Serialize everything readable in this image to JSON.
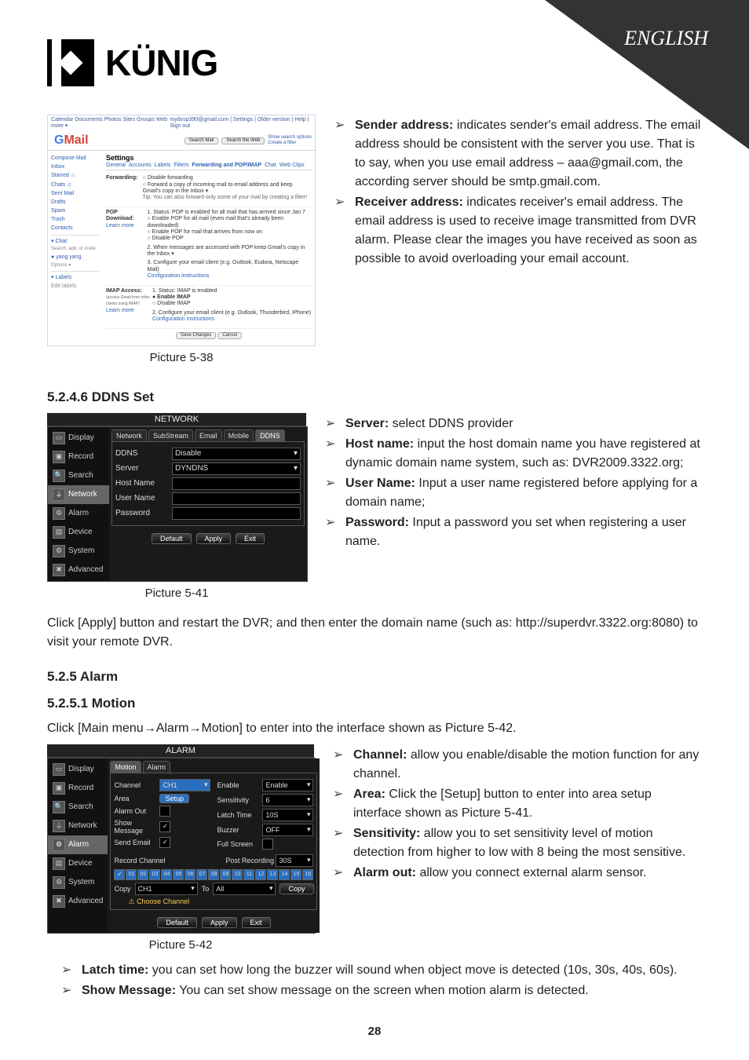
{
  "corner": {
    "language": "ENGLISH"
  },
  "logo": {
    "text": "KÜNIG"
  },
  "fig38": {
    "caption": "Picture 5-38",
    "gmail": {
      "topLeft": "Calendar Documents Photos Sites Groups Web more ▾",
      "topRight": "mydvsp390@gmail.com | Settings | Older version | Help | Sign out",
      "searchMail": "Search Mail",
      "searchWeb": "Search the Web",
      "searchHint": "Show search options\nCreate a filter",
      "logoG": "G",
      "logoMail": "Mail",
      "nav": [
        "Compose Mail",
        "Inbox",
        "Starred ☆",
        "Chats ♫",
        "Sent Mail",
        "Drafts",
        "Spam",
        "Trash",
        "Contacts",
        "▾ Chat",
        "Search, add, or invite",
        "● yang yang",
        "Options ▾",
        "▾ Labels",
        "Edit labels"
      ],
      "settingsTitle": "Settings",
      "tabs": [
        "General",
        "Accounts",
        "Labels",
        "Filters",
        "Forwarding and POP/IMAP",
        "Chat",
        "Web Clips"
      ],
      "fwdLabel": "Forwarding:",
      "fwd1": "○ Disable forwarding",
      "fwd2": "○ Forward a copy of incoming mail to  email address   and  keep Gmail's copy in the Inbox ▾",
      "fwdTip": "Tip: You can also forward only some of your mail by creating a filter!",
      "popLabel": "POP Download:",
      "popMore": "Learn more",
      "pop1": "1. Status: POP is enabled for all mail that has arrived since Jan 7",
      "pop2": "○ Enable POP for all mail (even mail that's already been downloaded)",
      "pop3": "○ Enable POP for mail that arrives from now on",
      "pop4": "○ Disable POP",
      "pop5": "2. When messages are accessed with POP  keep Gmail's copy in the Inbox   ▾",
      "pop6": "3. Configure your email client (e.g. Outlook, Eudora, Netscape Mail)",
      "pop7": "Configuration instructions",
      "imapLabel": "IMAP Access:",
      "imapSub": "(access Gmail from other clients using IMAP)",
      "imapMore": "Learn more",
      "imap1": "1. Status: IMAP is enabled",
      "imap2": "● Enable IMAP",
      "imap3": "○ Disable IMAP",
      "imap4": "2. Configure your email client (e.g. Outlook, Thunderbird, iPhone)",
      "imap5": "Configuration instructions",
      "save": "Save Changes",
      "cancel": "Cancel"
    }
  },
  "senderReceiver": {
    "senderLabel": "Sender address:",
    "senderBody": " indicates sender's email address. The email address should be consistent with the server you use. That is to say, when you use email address – aaa@gmail.com, the according server should be smtp.gmail.com.",
    "receiverLabel": "Receiver address:",
    "receiverBody": " indicates receiver's email address. The email address is used to receive image transmitted from DVR alarm. Please clear the images you have received as soon as possible to avoid overloading your email account."
  },
  "sec5246": {
    "title": "5.2.4.6 DDNS Set"
  },
  "fig41": {
    "caption": "Picture 5-41",
    "title": "NETWORK",
    "side": [
      "Display",
      "Record",
      "Search",
      "Network",
      "Alarm",
      "Device",
      "System",
      "Advanced"
    ],
    "tabs": [
      "Network",
      "SubStream",
      "Email",
      "Mobile",
      "DDNS"
    ],
    "rows": {
      "ddns": "DDNS",
      "ddnsVal": "Disable",
      "server": "Server",
      "serverVal": "DYNDNS",
      "host": "Host Name",
      "user": "User Name",
      "pass": "Password"
    },
    "btns": {
      "default": "Default",
      "apply": "Apply",
      "exit": "Exit"
    }
  },
  "ddnsBullets": {
    "server": "Server:",
    "serverTxt": " select DDNS provider",
    "host": "Host name:",
    "hostTxt": " input the host domain name you have registered at dynamic domain name system, such as: DVR2009.3322.org;",
    "user": "User Name:",
    "userTxt": " Input a user name registered before applying for a domain name;",
    "pass": "Password:",
    "passTxt": " Input a password you set when registering a user name."
  },
  "afterDdns": "Click [Apply] button and restart the DVR; and then enter the domain name (such as: http://superdvr.3322.org:8080) to visit your remote DVR.",
  "sec525": {
    "title": "5.2.5 Alarm"
  },
  "sec5251": {
    "title": "5.2.5.1 Motion",
    "lead": "Click [Main menu→Alarm→Motion] to enter into the interface shown as Picture 5-42."
  },
  "fig42": {
    "caption": "Picture 5-42",
    "title": "ALARM",
    "side": [
      "Display",
      "Record",
      "Search",
      "Network",
      "Alarm",
      "Device",
      "System",
      "Advanced"
    ],
    "tabs": [
      "Motion",
      "Alarm"
    ],
    "rows": {
      "channel": "Channel",
      "channelVal": "CH1",
      "enable": "Enable",
      "enableVal": "Enable",
      "area": "Area",
      "areaBtn": "Setup",
      "sens": "Sensitivity",
      "sensVal": "6",
      "alarmOut": "Alarm Out",
      "latch": "Latch Time",
      "latchVal": "10S",
      "showMsg": "Show Message",
      "buzzer": "Buzzer",
      "buzzerVal": "OFF",
      "sendEmail": "Send Email",
      "fullScreen": "Full Screen",
      "recCh": "Record Channel",
      "postRec": "Post Recording",
      "postRecVal": "30S",
      "channels": [
        "01",
        "02",
        "03",
        "04",
        "05",
        "06",
        "07",
        "08",
        "09",
        "10",
        "11",
        "12",
        "13",
        "14",
        "15",
        "16"
      ],
      "copy": "Copy",
      "copyCh": "CH1",
      "to": "To",
      "toAll": "All",
      "copyBtn": "Copy",
      "choose": "Choose Channel"
    },
    "btns": {
      "default": "Default",
      "apply": "Apply",
      "exit": "Exit"
    }
  },
  "alarmBullets": {
    "channel": "Channel:",
    "channelTxt": " allow you enable/disable the motion function for any channel.",
    "area": "Area:",
    "areaTxt": " Click the [Setup] button to enter into area setup interface shown as Picture 5-41.",
    "sens": "Sensitivity:",
    "sensTxt": " allow you to set sensitivity level of motion detection from higher to low with 8 being the most sensitive.",
    "alarmOut": "Alarm out:",
    "alarmOutTxt": " allow you connect external alarm sensor.",
    "latch": "Latch time:",
    "latchTxt": " you can set how long the buzzer will sound when object move is detected (10s, 30s, 40s, 60s).",
    "showMsg": "Show Message:",
    "showMsgTxt": " You can set show message on the screen when motion alarm is detected."
  },
  "pageNum": "28"
}
